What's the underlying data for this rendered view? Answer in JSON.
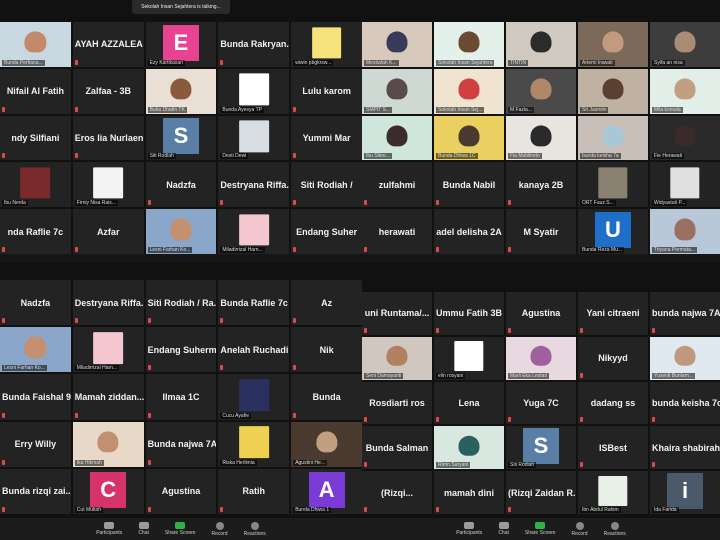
{
  "talking_banner": "Sekolah Insan Sejahtera is talking...",
  "toolbar": {
    "participants": "Participants",
    "participants_count": "99",
    "chat": "Chat",
    "share_screen": "Share Screen",
    "record": "Record",
    "reactions": "Reactions"
  },
  "top_left": [
    {
      "type": "video",
      "small": "Bunda Perfiana...",
      "bg": "#c9d8e0",
      "face": "#c28a6a"
    },
    {
      "type": "name",
      "big": "AYAH AZZALEA"
    },
    {
      "type": "letter",
      "small": "Ezy Kartikasari",
      "letter": "E",
      "color": "#e84393"
    },
    {
      "type": "name",
      "big": "Bunda  Rakryan..."
    },
    {
      "type": "image",
      "small": "wiwin pbgkrsw...",
      "bg": "#f5e27a"
    },
    {
      "type": "name",
      "big": "Nifail Al Fatih"
    },
    {
      "type": "name",
      "big": "Zalfaa - 3B"
    },
    {
      "type": "video",
      "small": "Bubu Dhafin TK",
      "bg": "#e9dfd4",
      "face": "#8b5a3c"
    },
    {
      "type": "image",
      "small": "Bunda Ayesya TP",
      "bg": "#ffffff"
    },
    {
      "type": "name",
      "big": "Lulu karom"
    },
    {
      "type": "name",
      "big": "ndy Silfiani"
    },
    {
      "type": "name",
      "big": "Eros lia Nurlaeni"
    },
    {
      "type": "letter",
      "small": "Siti Rodiah",
      "letter": "S",
      "color": "#5a7fa6"
    },
    {
      "type": "image",
      "small": "Desti Dewi",
      "bg": "#d8dde2"
    },
    {
      "type": "name",
      "big": "Yummi   Mar"
    },
    {
      "type": "image",
      "small": "Ibu Nerda",
      "bg": "#7a2a2a"
    },
    {
      "type": "image",
      "small": "Firniy Nisa Rais...",
      "bg": "#f4f4f4"
    },
    {
      "type": "name",
      "big": "Nadzfa"
    },
    {
      "type": "name",
      "big": "Destryana  Riffa..."
    },
    {
      "type": "name",
      "big": "Siti Rodiah / "
    },
    {
      "type": "name",
      "big": "nda Raflie 7c"
    },
    {
      "type": "name",
      "big": "Azfar"
    },
    {
      "type": "video",
      "small": "Lesni Farhan Ko...",
      "bg": "#8aa7c9",
      "face": "#c49070"
    },
    {
      "type": "image",
      "small": "Miladirrizal Harn...",
      "bg": "#f3c6d0"
    },
    {
      "type": "name",
      "big": "Endang  Suher"
    }
  ],
  "top_right": [
    {
      "type": "video",
      "small": "Mestiafah K...",
      "bg": "#d8c9bd",
      "face": "#3a3a5a"
    },
    {
      "type": "video",
      "small": "Sekolah Insan Sejahtera",
      "bg": "#e3f1ea",
      "face": "#6a4a30"
    },
    {
      "type": "video",
      "small": "TINTIN",
      "bg": "#cfc9c0",
      "face": "#2b2b2b"
    },
    {
      "type": "video",
      "small": "Artemi Irawati",
      "bg": "#7b6a5a",
      "face": "#c29a80"
    },
    {
      "type": "video",
      "small": "Syifa an nisa",
      "bg": "#3d3d3d",
      "face": "#a98b76"
    },
    {
      "type": "video",
      "small": "SMPIT S...",
      "bg": "#cfd9d4",
      "face": "#5a4a4a"
    },
    {
      "type": "video",
      "small": "Sekolah Insan Sej...",
      "bg": "#f0e4d0",
      "face": "#d04040",
      "speaking": true
    },
    {
      "type": "video",
      "small": "M Fazla...",
      "bg": "#4a4a4a",
      "face": "#b08868"
    },
    {
      "type": "video",
      "small": "Sri Jasmini",
      "bg": "#bfb2a2",
      "face": "#5a4030"
    },
    {
      "type": "video",
      "small": "Mila komala",
      "bg": "#e2efe9",
      "face": "#c0a080"
    },
    {
      "type": "video",
      "small": "Ibu Sitee...",
      "bg": "#cfe6dd",
      "face": "#3c2c2c"
    },
    {
      "type": "video",
      "small": "Bunda Dhiwa 1C",
      "bg": "#ead060",
      "face": "#4a3a30"
    },
    {
      "type": "video",
      "small": "Fia Mobilindo",
      "bg": "#e8e4e0",
      "face": "#2a2a2a"
    },
    {
      "type": "video",
      "small": "bunda keisha 7a",
      "bg": "#c8c0b8",
      "face": "#a8c8d8"
    },
    {
      "type": "video",
      "small": "Fie Herawati",
      "bg": "#2a2a2a",
      "face": "#3a2a2a"
    },
    {
      "type": "name",
      "big": "zulfahmi"
    },
    {
      "type": "name",
      "big": "Bunda Nabil"
    },
    {
      "type": "name",
      "big": "kanaya 2B"
    },
    {
      "type": "image",
      "small": "ORT Fauz S...",
      "bg": "#8a8070"
    },
    {
      "type": "image",
      "small": "Widyastuti P...",
      "bg": "#e0e0e0"
    },
    {
      "type": "name",
      "big": "herawati"
    },
    {
      "type": "name",
      "big": "adel delisha 2A"
    },
    {
      "type": "name",
      "big": "M Syatir"
    },
    {
      "type": "letter",
      "small": "Bunda Reza Mu...",
      "letter": "U",
      "color": "#1f6fc9"
    },
    {
      "type": "video",
      "small": "Triyana Permata...",
      "bg": "#b8c8d8",
      "face": "#9a7060"
    }
  ],
  "bottom_left": [
    {
      "type": "name",
      "big": "Nadzfa"
    },
    {
      "type": "name",
      "big": "Destryana  Riffa..."
    },
    {
      "type": "name",
      "big": "Siti Rodiah / Ra..."
    },
    {
      "type": "name",
      "big": "Bunda Raflie 7c"
    },
    {
      "type": "name",
      "big": "Az"
    },
    {
      "type": "video",
      "small": "Lesni Farhan Ko...",
      "bg": "#8aa7c9",
      "face": "#c49070"
    },
    {
      "type": "image",
      "small": "Miladirrizal Harn...",
      "bg": "#f3c6d0"
    },
    {
      "type": "name",
      "big": "Endang  Suherm..."
    },
    {
      "type": "name",
      "big": "Anelah  Ruchadi..."
    },
    {
      "type": "name",
      "big": "Nik"
    },
    {
      "type": "name",
      "big": "Bunda Faishal  9..."
    },
    {
      "type": "name",
      "big": "Mamah  ziddan..."
    },
    {
      "type": "name",
      "big": "Ilmaa 1C"
    },
    {
      "type": "image",
      "small": "Cucu Ayafie",
      "bg": "#2a3060"
    },
    {
      "type": "name",
      "big": "Bunda"
    },
    {
      "type": "name",
      "big": "Erry Willy"
    },
    {
      "type": "video",
      "small": "Ika Hikmah",
      "bg": "#e8d8c8",
      "face": "#c09070"
    },
    {
      "type": "name",
      "big": "Bunda najwa 7A"
    },
    {
      "type": "image",
      "small": "Riska Herlimia",
      "bg": "#f0d050"
    },
    {
      "type": "video",
      "small": "Agustini He...",
      "bg": "#4a3a30",
      "face": "#c0a080"
    },
    {
      "type": "name",
      "big": "Bunda rizqi  zai..."
    },
    {
      "type": "letter",
      "small": "Cut Mutiah",
      "letter": "C",
      "color": "#d6336c"
    },
    {
      "type": "name",
      "big": "Agustina"
    },
    {
      "type": "name",
      "big": "Ratih"
    },
    {
      "type": "letter",
      "small": "Bunda Dhiwa 1",
      "letter": "A",
      "color": "#7a3ad6"
    }
  ],
  "bottom_right": [
    {
      "type": "name",
      "big": "uni  Runtama/..."
    },
    {
      "type": "name",
      "big": "Ummu Fatih 3B"
    },
    {
      "type": "name",
      "big": "Agustina"
    },
    {
      "type": "name",
      "big": "Yani citraeni"
    },
    {
      "type": "name",
      "big": "bunda najwa 7A"
    },
    {
      "type": "video",
      "small": "Seni Damayanti",
      "bg": "#d0c8c0",
      "face": "#b08060"
    },
    {
      "type": "image",
      "small": "elin rosyani",
      "bg": "#ffffff"
    },
    {
      "type": "video",
      "small": "Marli Eka Lestari",
      "bg": "#e8d8e0",
      "face": "#a060a0"
    },
    {
      "type": "name",
      "big": "Nikyyd"
    },
    {
      "type": "video",
      "small": "Yusenti Bunlam...",
      "bg": "#e0e8f0",
      "face": "#c09880"
    },
    {
      "type": "name",
      "big": "Rosdiarti ros"
    },
    {
      "type": "name",
      "big": "Lena"
    },
    {
      "type": "name",
      "big": "Yuga 7C"
    },
    {
      "type": "name",
      "big": "dadang ss"
    },
    {
      "type": "name",
      "big": "bunda keisha 7c"
    },
    {
      "type": "name",
      "big": "Bunda Salman"
    },
    {
      "type": "video",
      "small": "Rirrin Suryani",
      "bg": "#d8e8e0",
      "face": "#2a6060"
    },
    {
      "type": "letter",
      "small": "Siti Rodiah",
      "letter": "S",
      "color": "#5a7fa6"
    },
    {
      "type": "name",
      "big": "ISBest"
    },
    {
      "type": "name",
      "big": "Khaira  shabirah..."
    },
    {
      "type": "name",
      "big": "(Rizqi..."
    },
    {
      "type": "name",
      "big": "mamah dini"
    },
    {
      "type": "name",
      "big": "(Rizqi  Zaidan  R..."
    },
    {
      "type": "image",
      "small": "Ibn Abdul Rahim",
      "bg": "#e8f0e8"
    },
    {
      "type": "letter",
      "small": "Ida Farida",
      "letter": "i",
      "color": "#4a5a6a"
    }
  ]
}
